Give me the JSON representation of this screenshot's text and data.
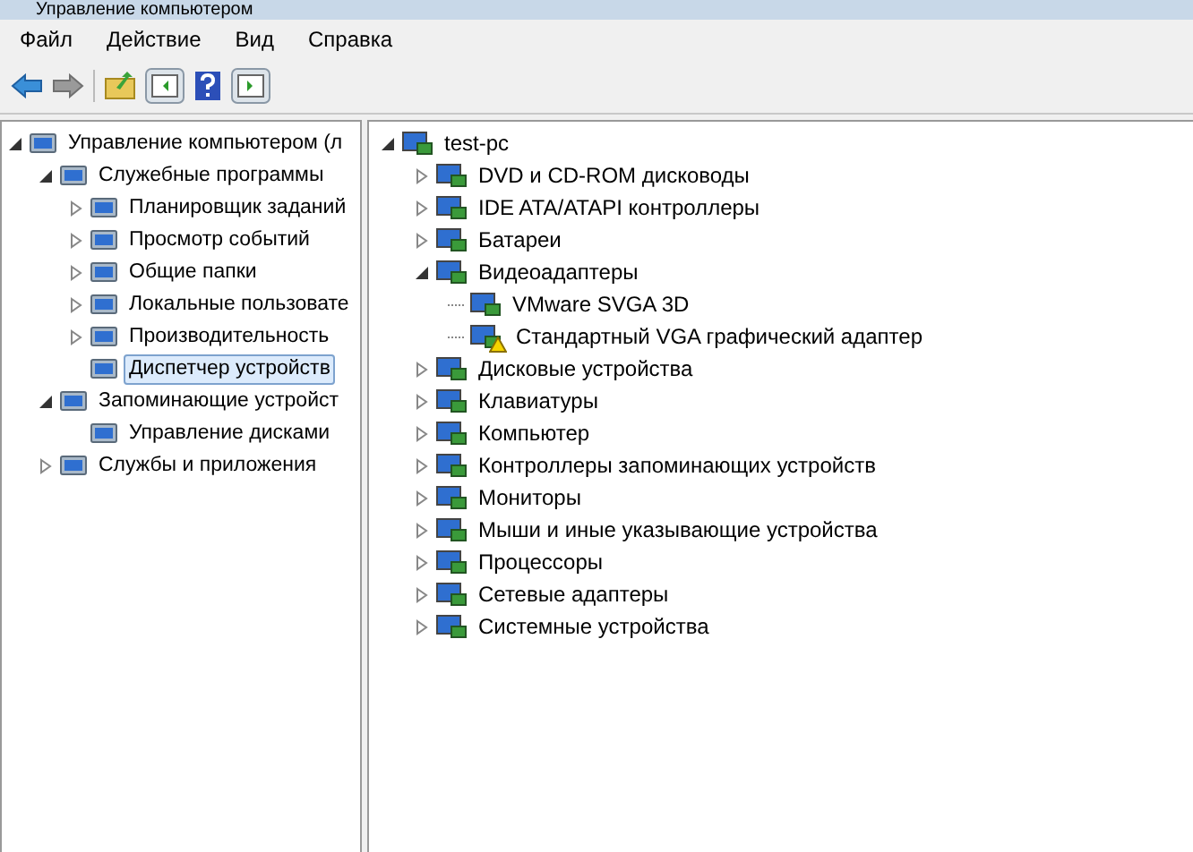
{
  "window": {
    "title": "Управление компьютером"
  },
  "menu": [
    "Файл",
    "Действие",
    "Вид",
    "Справка"
  ],
  "nav_tree": [
    {
      "label": "Управление компьютером (л",
      "selected": false,
      "expanded": true,
      "children": [
        {
          "label": "Служебные программы",
          "selected": false,
          "expanded": true,
          "children": [
            {
              "label": "Планировщик заданий",
              "selected": false,
              "expanded": false
            },
            {
              "label": "Просмотр событий",
              "selected": false,
              "expanded": false
            },
            {
              "label": "Общие папки",
              "selected": false,
              "expanded": false
            },
            {
              "label": "Локальные пользовате",
              "selected": false,
              "expanded": false
            },
            {
              "label": "Производительность",
              "selected": false,
              "expanded": false
            },
            {
              "label": "Диспетчер устройств",
              "selected": true
            }
          ]
        },
        {
          "label": "Запоминающие устройст",
          "selected": false,
          "expanded": true,
          "children": [
            {
              "label": "Управление дисками",
              "selected": false
            }
          ]
        },
        {
          "label": "Службы и приложения",
          "selected": false,
          "expanded": false
        }
      ]
    }
  ],
  "device_tree": [
    {
      "label": "test-pc",
      "expanded": true,
      "children": [
        {
          "label": "DVD и CD-ROM дисководы",
          "expanded": false
        },
        {
          "label": "IDE ATA/ATAPI контроллеры",
          "expanded": false
        },
        {
          "label": "Батареи",
          "expanded": false
        },
        {
          "label": "Видеоадаптеры",
          "expanded": true,
          "children": [
            {
              "label": "VMware SVGA 3D",
              "warning": false
            },
            {
              "label": "Стандартный VGA графический адаптер",
              "warning": true
            }
          ]
        },
        {
          "label": "Дисковые устройства",
          "expanded": false
        },
        {
          "label": "Клавиатуры",
          "expanded": false
        },
        {
          "label": "Компьютер",
          "expanded": false
        },
        {
          "label": "Контроллеры запоминающих устройств",
          "expanded": false
        },
        {
          "label": "Мониторы",
          "expanded": false
        },
        {
          "label": "Мыши и иные указывающие устройства",
          "expanded": false
        },
        {
          "label": "Процессоры",
          "expanded": false
        },
        {
          "label": "Сетевые адаптеры",
          "expanded": false
        },
        {
          "label": "Системные устройства",
          "expanded": false
        }
      ]
    }
  ]
}
